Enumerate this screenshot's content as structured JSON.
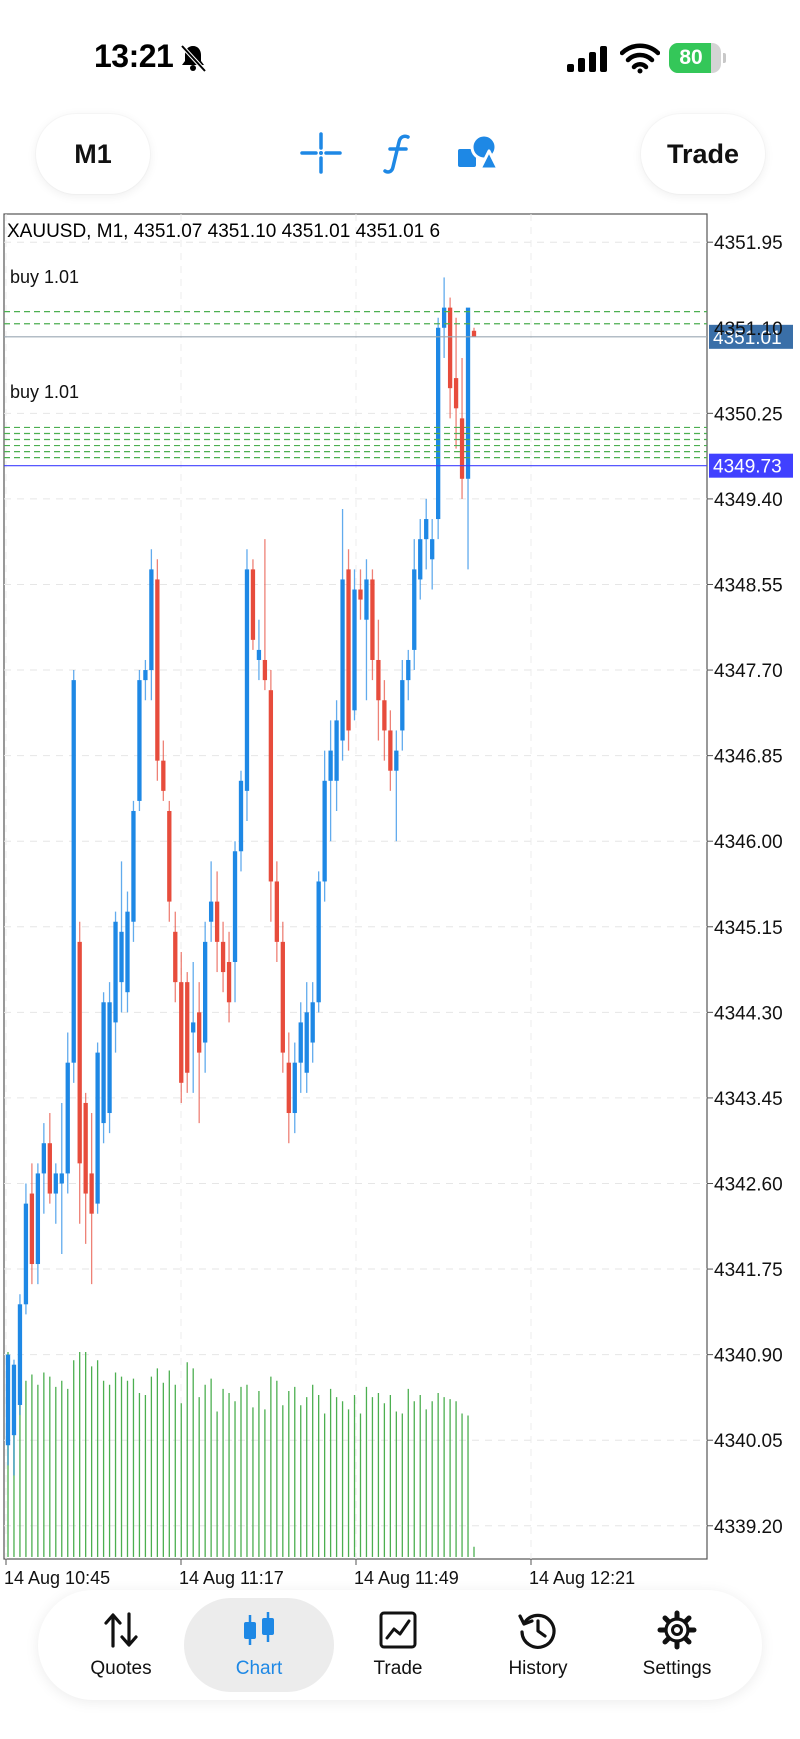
{
  "status_bar": {
    "time": "13:21",
    "battery_percent": 80,
    "battery_text": "80"
  },
  "toolbar": {
    "timeframe_label": "M1",
    "trade_label": "Trade",
    "icons": [
      "crosshair-icon",
      "function-icon",
      "objects-icon"
    ],
    "accent_color": "#1e88e5"
  },
  "chart": {
    "header": "XAUUSD, M1, 4351.07 4351.10 4351.01 4351.01 6",
    "bid_tag": "4351.01",
    "ask_tag": "4349.73",
    "partial_price_label": "4351.10",
    "position_labels": [
      "buy 1.01",
      "buy 1.01"
    ],
    "time_labels": [
      "14 Aug 10:45",
      "14 Aug 11:17",
      "14 Aug 11:49",
      "14 Aug 12:21"
    ]
  },
  "chart_data": {
    "type": "candlestick",
    "symbol": "XAUUSD",
    "timeframe": "M1",
    "ohlc_header": {
      "open": 4351.07,
      "high": 4351.1,
      "low": 4351.01,
      "close": 4351.01,
      "tick_volume": 6
    },
    "y_ticks": [
      4351.95,
      4350.25,
      4349.4,
      4348.55,
      4347.7,
      4346.85,
      4346.0,
      4345.15,
      4344.3,
      4343.45,
      4342.6,
      4341.75,
      4340.9,
      4340.05,
      4339.2
    ],
    "y_range": [
      4338.87,
      4352.23
    ],
    "bid_line": 4351.01,
    "ask_line": 4349.73,
    "position_lines": [
      4351.26,
      4351.14,
      4350.11,
      4350.05,
      4349.99,
      4349.93,
      4349.87,
      4349.81
    ],
    "candles": [
      {
        "o": 4340.0,
        "h": 4340.9,
        "l": 4339.8,
        "c": 4340.9
      },
      {
        "o": 4340.1,
        "h": 4340.85,
        "l": 4339.7,
        "c": 4340.8
      },
      {
        "o": 4340.4,
        "h": 4341.5,
        "l": 4340.3,
        "c": 4341.4
      },
      {
        "o": 4341.4,
        "h": 4342.6,
        "l": 4341.3,
        "c": 4342.4
      },
      {
        "o": 4342.5,
        "h": 4342.8,
        "l": 4341.6,
        "c": 4341.8
      },
      {
        "o": 4341.8,
        "h": 4342.8,
        "l": 4341.6,
        "c": 4342.7
      },
      {
        "o": 4342.7,
        "h": 4343.2,
        "l": 4342.3,
        "c": 4343.0
      },
      {
        "o": 4343.0,
        "h": 4343.3,
        "l": 4342.4,
        "c": 4342.5
      },
      {
        "o": 4342.5,
        "h": 4342.8,
        "l": 4342.2,
        "c": 4342.7
      },
      {
        "o": 4342.6,
        "h": 4343.4,
        "l": 4341.9,
        "c": 4342.7
      },
      {
        "o": 4342.7,
        "h": 4344.1,
        "l": 4342.5,
        "c": 4343.8
      },
      {
        "o": 4343.8,
        "h": 4347.7,
        "l": 4343.6,
        "c": 4347.6
      },
      {
        "o": 4345.0,
        "h": 4345.2,
        "l": 4342.2,
        "c": 4342.8
      },
      {
        "o": 4343.4,
        "h": 4343.5,
        "l": 4342.0,
        "c": 4342.5
      },
      {
        "o": 4342.7,
        "h": 4343.3,
        "l": 4341.6,
        "c": 4342.3
      },
      {
        "o": 4342.4,
        "h": 4344.0,
        "l": 4342.3,
        "c": 4343.9
      },
      {
        "o": 4343.2,
        "h": 4344.5,
        "l": 4343.0,
        "c": 4344.4
      },
      {
        "o": 4343.3,
        "h": 4344.6,
        "l": 4343.1,
        "c": 4344.4
      },
      {
        "o": 4344.2,
        "h": 4345.3,
        "l": 4343.9,
        "c": 4345.2
      },
      {
        "o": 4344.6,
        "h": 4345.8,
        "l": 4344.3,
        "c": 4345.1
      },
      {
        "o": 4344.5,
        "h": 4345.5,
        "l": 4344.3,
        "c": 4345.3
      },
      {
        "o": 4345.2,
        "h": 4346.4,
        "l": 4345.0,
        "c": 4346.3
      },
      {
        "o": 4346.4,
        "h": 4347.7,
        "l": 4346.3,
        "c": 4347.6
      },
      {
        "o": 4347.6,
        "h": 4347.8,
        "l": 4347.4,
        "c": 4347.7
      },
      {
        "o": 4347.7,
        "h": 4348.9,
        "l": 4347.4,
        "c": 4348.7
      },
      {
        "o": 4348.6,
        "h": 4348.8,
        "l": 4346.6,
        "c": 4346.8
      },
      {
        "o": 4346.8,
        "h": 4347.0,
        "l": 4346.4,
        "c": 4346.5
      },
      {
        "o": 4346.3,
        "h": 4346.4,
        "l": 4345.2,
        "c": 4345.4
      },
      {
        "o": 4345.1,
        "h": 4345.3,
        "l": 4344.4,
        "c": 4344.6
      },
      {
        "o": 4344.6,
        "h": 4344.9,
        "l": 4343.4,
        "c": 4343.6
      },
      {
        "o": 4344.6,
        "h": 4344.7,
        "l": 4343.5,
        "c": 4343.7
      },
      {
        "o": 4344.1,
        "h": 4344.8,
        "l": 4343.5,
        "c": 4344.2
      },
      {
        "o": 4344.3,
        "h": 4344.6,
        "l": 4343.2,
        "c": 4343.9
      },
      {
        "o": 4344.0,
        "h": 4345.2,
        "l": 4343.7,
        "c": 4345.0
      },
      {
        "o": 4345.2,
        "h": 4345.8,
        "l": 4345.0,
        "c": 4345.4
      },
      {
        "o": 4345.4,
        "h": 4345.7,
        "l": 4344.7,
        "c": 4345.0
      },
      {
        "o": 4345.0,
        "h": 4345.2,
        "l": 4344.5,
        "c": 4344.7
      },
      {
        "o": 4344.8,
        "h": 4345.1,
        "l": 4344.2,
        "c": 4344.4
      },
      {
        "o": 4344.8,
        "h": 4346.0,
        "l": 4344.4,
        "c": 4345.9
      },
      {
        "o": 4345.9,
        "h": 4346.7,
        "l": 4345.7,
        "c": 4346.6
      },
      {
        "o": 4346.5,
        "h": 4348.9,
        "l": 4346.2,
        "c": 4348.7
      },
      {
        "o": 4348.7,
        "h": 4348.8,
        "l": 4347.9,
        "c": 4348.0
      },
      {
        "o": 4347.8,
        "h": 4348.2,
        "l": 4347.6,
        "c": 4347.9
      },
      {
        "o": 4347.8,
        "h": 4349.0,
        "l": 4347.5,
        "c": 4347.6
      },
      {
        "o": 4347.5,
        "h": 4347.7,
        "l": 4345.2,
        "c": 4345.6
      },
      {
        "o": 4345.6,
        "h": 4345.8,
        "l": 4344.8,
        "c": 4345.0
      },
      {
        "o": 4345.0,
        "h": 4345.2,
        "l": 4343.7,
        "c": 4343.9
      },
      {
        "o": 4343.8,
        "h": 4344.1,
        "l": 4343.0,
        "c": 4343.3
      },
      {
        "o": 4343.3,
        "h": 4344.0,
        "l": 4343.1,
        "c": 4343.8
      },
      {
        "o": 4343.8,
        "h": 4344.4,
        "l": 4343.5,
        "c": 4344.2
      },
      {
        "o": 4343.7,
        "h": 4344.6,
        "l": 4343.5,
        "c": 4344.3
      },
      {
        "o": 4344.0,
        "h": 4344.6,
        "l": 4343.8,
        "c": 4344.4
      },
      {
        "o": 4344.4,
        "h": 4345.7,
        "l": 4344.3,
        "c": 4345.6
      },
      {
        "o": 4345.6,
        "h": 4346.9,
        "l": 4345.4,
        "c": 4346.6
      },
      {
        "o": 4346.6,
        "h": 4347.2,
        "l": 4346.0,
        "c": 4346.9
      },
      {
        "o": 4346.6,
        "h": 4347.4,
        "l": 4346.3,
        "c": 4347.2
      },
      {
        "o": 4347.0,
        "h": 4349.3,
        "l": 4346.8,
        "c": 4348.6
      },
      {
        "o": 4348.7,
        "h": 4348.9,
        "l": 4346.9,
        "c": 4347.1
      },
      {
        "o": 4347.3,
        "h": 4348.7,
        "l": 4347.2,
        "c": 4348.5
      },
      {
        "o": 4348.5,
        "h": 4348.7,
        "l": 4348.2,
        "c": 4348.4
      },
      {
        "o": 4348.2,
        "h": 4348.8,
        "l": 4347.4,
        "c": 4348.6
      },
      {
        "o": 4348.6,
        "h": 4348.7,
        "l": 4347.6,
        "c": 4347.8
      },
      {
        "o": 4347.8,
        "h": 4348.2,
        "l": 4347.0,
        "c": 4347.4
      },
      {
        "o": 4347.4,
        "h": 4347.6,
        "l": 4346.8,
        "c": 4347.1
      },
      {
        "o": 4347.1,
        "h": 4347.3,
        "l": 4346.5,
        "c": 4346.7
      },
      {
        "o": 4346.7,
        "h": 4347.1,
        "l": 4346.0,
        "c": 4346.9
      },
      {
        "o": 4347.1,
        "h": 4347.8,
        "l": 4346.9,
        "c": 4347.6
      },
      {
        "o": 4347.6,
        "h": 4347.9,
        "l": 4347.4,
        "c": 4347.8
      },
      {
        "o": 4347.9,
        "h": 4349.0,
        "l": 4347.7,
        "c": 4348.7
      },
      {
        "o": 4348.6,
        "h": 4349.2,
        "l": 4348.4,
        "c": 4349.0
      },
      {
        "o": 4349.0,
        "h": 4349.4,
        "l": 4348.7,
        "c": 4349.2
      },
      {
        "o": 4348.8,
        "h": 4349.2,
        "l": 4348.5,
        "c": 4349.0
      },
      {
        "o": 4349.2,
        "h": 4351.2,
        "l": 4349.0,
        "c": 4351.1
      },
      {
        "o": 4351.1,
        "h": 4351.6,
        "l": 4350.8,
        "c": 4351.3
      },
      {
        "o": 4351.3,
        "h": 4351.4,
        "l": 4350.2,
        "c": 4350.5
      },
      {
        "o": 4350.6,
        "h": 4351.2,
        "l": 4349.9,
        "c": 4350.3
      },
      {
        "o": 4350.2,
        "h": 4350.8,
        "l": 4349.4,
        "c": 4349.6
      },
      {
        "o": 4349.6,
        "h": 4351.1,
        "l": 4348.7,
        "c": 4351.3
      },
      {
        "o": 4351.07,
        "h": 4351.1,
        "l": 4351.01,
        "c": 4351.01
      }
    ],
    "volume": [
      1.0,
      0.88,
      0.9,
      0.86,
      0.89,
      0.84,
      0.9,
      0.88,
      0.83,
      0.86,
      0.82,
      0.96,
      1.0,
      1.0,
      0.93,
      0.96,
      0.86,
      0.84,
      0.9,
      0.88,
      0.86,
      0.87,
      0.8,
      0.79,
      0.88,
      0.92,
      0.85,
      0.91,
      0.84,
      0.75,
      0.95,
      0.92,
      0.78,
      0.84,
      0.87,
      0.71,
      0.82,
      0.8,
      0.76,
      0.83,
      0.84,
      0.73,
      0.81,
      0.72,
      0.88,
      0.86,
      0.74,
      0.81,
      0.83,
      0.74,
      0.78,
      0.84,
      0.79,
      0.7,
      0.82,
      0.78,
      0.76,
      0.72,
      0.79,
      0.7,
      0.83,
      0.78,
      0.8,
      0.75,
      0.79,
      0.71,
      0.7,
      0.82,
      0.76,
      0.79,
      0.72,
      0.76,
      0.8,
      0.78,
      0.77,
      0.76,
      0.7,
      0.69,
      0.05
    ],
    "grid": true,
    "bull_color": "#1e88e5",
    "bear_color": "#e74c3c",
    "volume_color": "#4caf50",
    "position_line_color": "#4caf50",
    "ask_line_color": "#4040ff",
    "bid_tag_color": "#3a6fa8"
  },
  "bottom_nav": {
    "items": [
      {
        "label": "Quotes",
        "icon": "quotes-arrows-icon"
      },
      {
        "label": "Chart",
        "icon": "candlestick-icon"
      },
      {
        "label": "Trade",
        "icon": "trade-chart-icon"
      },
      {
        "label": "History",
        "icon": "history-clock-icon"
      },
      {
        "label": "Settings",
        "icon": "gear-icon"
      }
    ],
    "active_index": 1
  }
}
